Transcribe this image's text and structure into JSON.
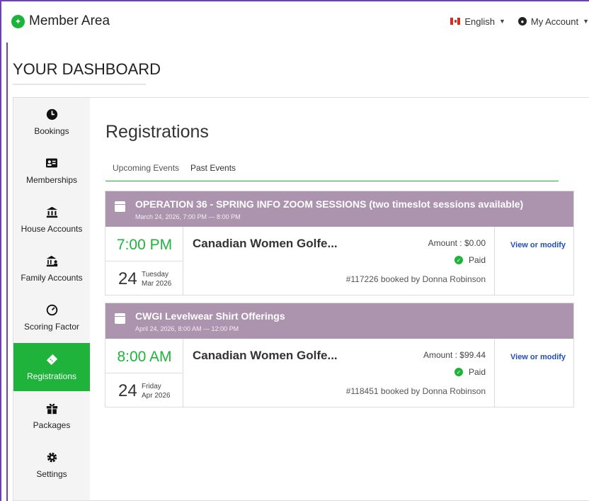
{
  "app": {
    "brand": "Member Area"
  },
  "nav": {
    "language": "English",
    "account": "My Account"
  },
  "dashboard": {
    "title": "YOUR DASHBOARD"
  },
  "sidebar": {
    "items": [
      {
        "label": "Bookings",
        "icon": "clock-icon"
      },
      {
        "label": "Memberships",
        "icon": "id-card-icon"
      },
      {
        "label": "House Accounts",
        "icon": "bank-icon"
      },
      {
        "label": "Family Accounts",
        "icon": "family-bank-icon"
      },
      {
        "label": "Scoring Factor",
        "icon": "gauge-icon"
      },
      {
        "label": "Registrations",
        "icon": "ticket-icon"
      },
      {
        "label": "Packages",
        "icon": "gift-icon"
      },
      {
        "label": "Settings",
        "icon": "gear-icon"
      }
    ],
    "active": "Registrations"
  },
  "main": {
    "title": "Registrations",
    "tabs": [
      {
        "label": "Upcoming Events",
        "selected": true
      },
      {
        "label": "Past Events",
        "selected": false
      }
    ],
    "events": [
      {
        "name": "OPERATION 36 - SPRING INFO ZOOM SESSIONS (two timeslot sessions available)",
        "date_range": "March 24, 2026, 7:00 PM — 8:00 PM",
        "time": "7:00 PM",
        "day": "24",
        "weekday": "Tuesday",
        "month_year": "Mar 2026",
        "club": "Canadian Women Golfe...",
        "amount": "Amount : $0.00",
        "status": "Paid",
        "booking": "#117226 booked by Donna Robinson",
        "action": "View or modify"
      },
      {
        "name": "CWGI Levelwear Shirt Offerings",
        "date_range": "April 24, 2026, 8:00 AM — 12:00 PM",
        "time": "8:00 AM",
        "day": "24",
        "weekday": "Friday",
        "month_year": "Apr 2026",
        "club": "Canadian Women Golfe...",
        "amount": "Amount : $99.44",
        "status": "Paid",
        "booking": "#118451 booked by Donna Robinson",
        "action": "View or modify"
      }
    ]
  },
  "colors": {
    "accent": "#1fb33b",
    "event_header": "#ac94af",
    "link": "#1f4fbf",
    "frame": "#6f42a8"
  }
}
